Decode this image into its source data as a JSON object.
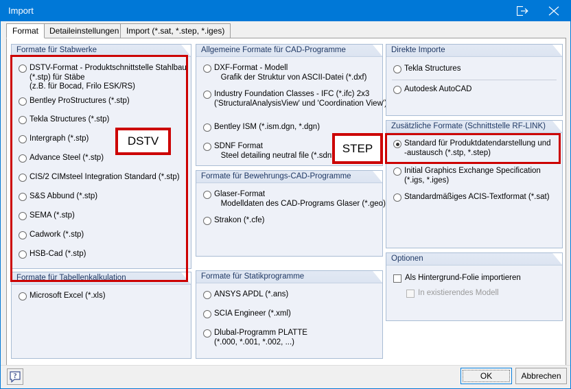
{
  "window": {
    "title": "Import",
    "titlebar_buttons": [
      {
        "name": "export-icon",
        "tooltip": "Export"
      },
      {
        "name": "close-icon",
        "tooltip": "Close"
      }
    ],
    "accent_color": "#0078d7"
  },
  "tabs": [
    {
      "label": "Format",
      "active": true
    },
    {
      "label": "Detaileinstellungen",
      "active": false
    },
    {
      "label": "Import (*.sat, *.step, *.iges)",
      "active": false
    }
  ],
  "groups": {
    "stabwerke": {
      "title": "Formate für Stabwerke",
      "options": [
        {
          "label": "DSTV-Format - Produktschnittstelle Stahlbau\n(*.stp) für Stäbe\n(z.B. für Bocad, Frilo ESK/RS)",
          "checked": false
        },
        {
          "label": "Bentley ProStructures (*.stp)",
          "checked": false
        },
        {
          "label": "Tekla Structures (*.stp)",
          "checked": false
        },
        {
          "label": "Intergraph (*.stp)",
          "checked": false
        },
        {
          "label": "Advance Steel (*.stp)",
          "checked": false
        },
        {
          "label": "CIS/2 CIMsteel Integration Standard (*.stp)",
          "checked": false
        },
        {
          "label": "S&S Abbund (*.stp)",
          "checked": false
        },
        {
          "label": "SEMA (*.stp)",
          "checked": false
        },
        {
          "label": "Cadwork (*.stp)",
          "checked": false
        },
        {
          "label": "HSB-Cad (*.stp)",
          "checked": false
        }
      ]
    },
    "tabellenkalkulation": {
      "title": "Formate für Tabellenkalkulation",
      "options": [
        {
          "label": "Microsoft Excel (*.xls)",
          "checked": false
        }
      ]
    },
    "cad": {
      "title": "Allgemeine Formate für CAD-Programme",
      "options": [
        {
          "label": "DXF-Format - Modell\n   Grafik der Struktur von ASCII-Datei (*.dxf)",
          "checked": false
        },
        {
          "label": "Industry Foundation Classes - IFC (*.ifc) 2x3\n('StructuralAnalysisView' und 'Coordination View')",
          "checked": false
        },
        {
          "label": "Bentley ISM (*.ism.dgn, *.dgn)",
          "checked": false
        },
        {
          "label": "SDNF Format\n   Steel detailing neutral file (*.sdnf, *.d",
          "checked": false
        }
      ]
    },
    "bewehrung": {
      "title": "Formate für Bewehrungs-CAD-Programme",
      "options": [
        {
          "label": "Glaser-Format\n   Modelldaten des CAD-Programs Glaser (*.geo)",
          "checked": false
        },
        {
          "label": "Strakon (*.cfe)",
          "checked": false
        }
      ]
    },
    "statik": {
      "title": "Formate für Statikprogramme",
      "options": [
        {
          "label": "ANSYS APDL (*.ans)",
          "checked": false
        },
        {
          "label": "SCIA Engineer (*.xml)",
          "checked": false
        },
        {
          "label": "Dlubal-Programm PLATTE\n(*.000, *.001, *.002, ...)",
          "checked": false
        }
      ]
    },
    "direkte": {
      "title": "Direkte Importe",
      "options": [
        {
          "label": "Tekla Structures",
          "checked": false
        },
        {
          "label": "Autodesk AutoCAD",
          "checked": false
        }
      ]
    },
    "rflink": {
      "title": "Zusätzliche Formate (Schnittstelle RF-LINK)",
      "options": [
        {
          "label": "Standard für Produktdatendarstellung und\n-austausch (*.stp, *.step)",
          "checked": true
        },
        {
          "label": "Initial Graphics Exchange Specification\n(*.igs, *.iges)",
          "checked": false
        },
        {
          "label": "Standardmäßiges ACIS-Textformat (*.sat)",
          "checked": false
        }
      ]
    },
    "optionen": {
      "title": "Optionen",
      "checkboxes": [
        {
          "label": "Als Hintergrund-Folie importieren",
          "checked": false,
          "disabled": false
        },
        {
          "label": "In existierendes Modell",
          "checked": false,
          "disabled": true
        }
      ]
    }
  },
  "annotations": {
    "color": "#cc0000",
    "dstv_label": "DSTV",
    "step_label": "STEP"
  },
  "footer": {
    "help_label": "?",
    "ok_label": "OK",
    "cancel_label": "Abbrechen"
  }
}
